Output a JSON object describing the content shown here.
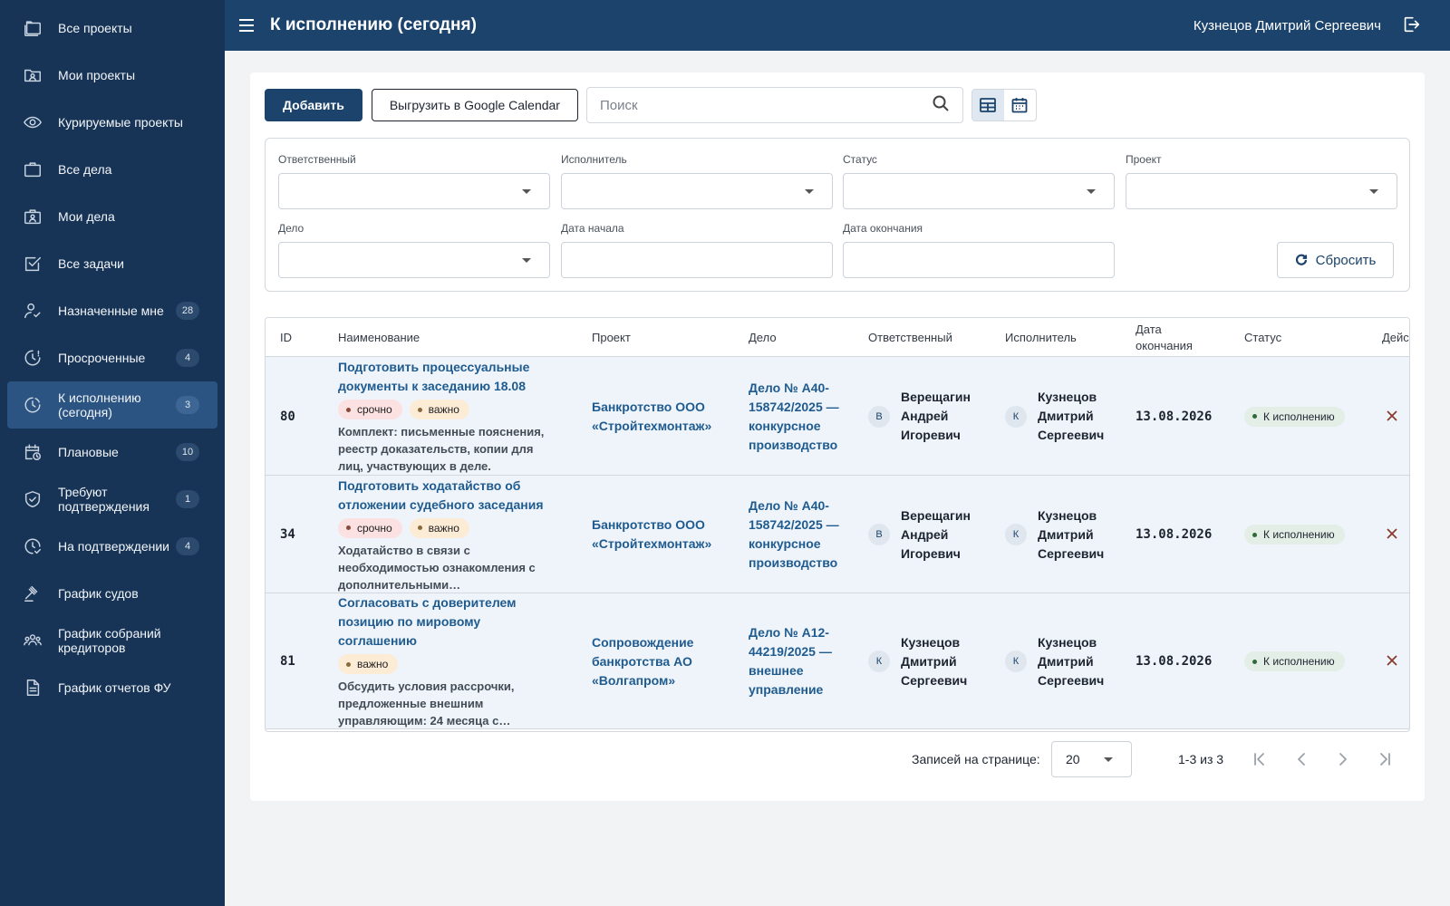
{
  "header": {
    "title": "К исполнению (сегодня)",
    "user_name": "Кузнецов Дмитрий Сергеевич"
  },
  "sidebar": {
    "items": [
      {
        "label": "Все проекты",
        "icon": "folders-icon",
        "badge": ""
      },
      {
        "label": "Мои проекты",
        "icon": "user-folder-icon",
        "badge": ""
      },
      {
        "label": "Курируемые проекты",
        "icon": "eye-icon",
        "badge": ""
      },
      {
        "label": "Все дела",
        "icon": "briefcase-icon",
        "badge": ""
      },
      {
        "label": "Мои дела",
        "icon": "user-briefcase-icon",
        "badge": ""
      },
      {
        "label": "Все задачи",
        "icon": "checkbox-icon",
        "badge": ""
      },
      {
        "label": "Назначенные мне",
        "icon": "user-assigned-icon",
        "badge": "28"
      },
      {
        "label": "Просроченные",
        "icon": "clock-overdue-icon",
        "badge": "4"
      },
      {
        "label": "К исполнению (сегодня)",
        "icon": "clock-today-icon",
        "badge": "3",
        "active": true
      },
      {
        "label": "Плановые",
        "icon": "calendar-clock-icon",
        "badge": "10"
      },
      {
        "label": "Требуют подтверждения",
        "icon": "shield-check-icon",
        "badge": "1"
      },
      {
        "label": "На подтверждении",
        "icon": "clock-check-icon",
        "badge": "4"
      },
      {
        "label": "График судов",
        "icon": "gavel-icon",
        "badge": ""
      },
      {
        "label": "График собраний кредиторов",
        "icon": "group-icon",
        "badge": ""
      },
      {
        "label": "График отчетов ФУ",
        "icon": "report-icon",
        "badge": ""
      }
    ]
  },
  "toolbar": {
    "add_label": "Добавить",
    "export_label": "Выгрузить в Google Calendar",
    "search_placeholder": "Поиск",
    "search_value": ""
  },
  "filters": {
    "responsible_label": "Ответственный",
    "executor_label": "Исполнитель",
    "status_label": "Статус",
    "project_label": "Проект",
    "case_label": "Дело",
    "date_start_label": "Дата начала",
    "date_end_label": "Дата окончания",
    "reset_label": "Сбросить"
  },
  "table": {
    "columns": [
      "ID",
      "Наименование",
      "Проект",
      "Дело",
      "Ответственный",
      "Исполнитель",
      "Дата окончания",
      "Статус",
      "Действия"
    ],
    "rows": [
      {
        "id": "80",
        "title": "Подготовить процессуальные документы к заседанию 18.08",
        "tags": [
          {
            "label": "срочно",
            "color": "red"
          },
          {
            "label": "важно",
            "color": "yellow"
          }
        ],
        "description": "Комплект: письменные пояснения, реестр доказательств, копии для лиц, участвующих в деле.",
        "project": "Банкротство ООО «Стройтехмонтаж»",
        "case": "Дело № А40-158742/2025 — конкурсное производство",
        "responsible": {
          "initial": "В",
          "name": "Верещагин Андрей Игоревич"
        },
        "executor": {
          "initial": "К",
          "name": "Кузнецов Дмитрий Сергеевич"
        },
        "end_date": "13.08.2026",
        "status": "К исполнению"
      },
      {
        "id": "34",
        "title": "Подготовить ходатайство об отложении судебного заседания",
        "tags": [
          {
            "label": "срочно",
            "color": "red"
          },
          {
            "label": "важно",
            "color": "yellow"
          }
        ],
        "description": "Ходатайство в связи с необходимостью ознакомления с дополнительными…",
        "project": "Банкротство ООО «Стройтехмонтаж»",
        "case": "Дело № А40-158742/2025 — конкурсное производство",
        "responsible": {
          "initial": "В",
          "name": "Верещагин Андрей Игоревич"
        },
        "executor": {
          "initial": "К",
          "name": "Кузнецов Дмитрий Сергеевич"
        },
        "end_date": "13.08.2026",
        "status": "К исполнению"
      },
      {
        "id": "81",
        "title": "Согласовать с доверителем позицию по мировому соглашению",
        "tags": [
          {
            "label": "важно",
            "color": "yellow"
          }
        ],
        "description": "Обсудить условия рассрочки, предложенные внешним управляющим: 24 месяца с…",
        "project": "Сопровождение банкротства АО «Волгапром»",
        "case": "Дело № А12-44219/2025 — внешнее управление",
        "responsible": {
          "initial": "К",
          "name": "Кузнецов Дмитрий Сергеевич"
        },
        "executor": {
          "initial": "К",
          "name": "Кузнецов Дмитрий Сергеевич"
        },
        "end_date": "13.08.2026",
        "status": "К исполнению"
      }
    ]
  },
  "pagination": {
    "per_page_label": "Записей на странице:",
    "per_page_value": "20",
    "range": "1-3 из 3"
  },
  "colors": {
    "sidebar_bg": "#173456",
    "header_bg": "#1b436c",
    "accent": "#1b436c",
    "link": "#1f5b8f",
    "row_bg": "#eef4fa"
  }
}
